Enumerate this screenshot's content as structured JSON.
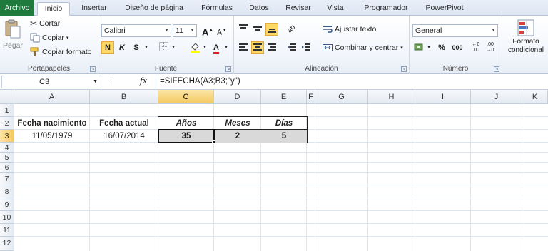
{
  "tabs": [
    "Archivo",
    "Inicio",
    "Insertar",
    "Diseño de página",
    "Fórmulas",
    "Datos",
    "Revisar",
    "Vista",
    "Programador",
    "PowerPivot"
  ],
  "clipboard": {
    "paste_label": "Pegar",
    "cut_label": "Cortar",
    "copy_label": "Copiar",
    "format_painter_label": "Copiar formato",
    "group_label": "Portapapeles"
  },
  "font": {
    "font_name": "Calibri",
    "font_size": "11",
    "bold_glyph": "N",
    "italic_glyph": "K",
    "underline_glyph": "S",
    "grow_glyph": "A",
    "shrink_glyph": "A",
    "group_label": "Fuente"
  },
  "alignment": {
    "wrap_text_label": "Ajustar texto",
    "merge_center_label": "Combinar y centrar",
    "group_label": "Alineación"
  },
  "number": {
    "format": "General",
    "percent_glyph": "%",
    "thousands_glyph": "000",
    "group_label": "Número"
  },
  "styles": {
    "conditional_format_label_1": "Formato",
    "conditional_format_label_2": "condicional"
  },
  "formula_bar": {
    "name_box": "C3",
    "fx": "fx",
    "formula": "=SIFECHA(A3;B3;\"y\")"
  },
  "columns": [
    "A",
    "B",
    "C",
    "D",
    "E",
    "F",
    "G",
    "H",
    "I",
    "J",
    "K"
  ],
  "rows": [
    "1",
    "2",
    "3",
    "4",
    "5",
    "6",
    "7",
    "8",
    "9",
    "10",
    "11",
    "12"
  ],
  "cells": {
    "a2": "Fecha nacimiento",
    "b2": "Fecha actual",
    "c2": "Años",
    "d2": "Meses",
    "e2": "Días",
    "a3": "11/05/1979",
    "b3": "16/07/2014",
    "c3": "35",
    "d3": "2",
    "e3": "5"
  },
  "colors": {
    "file_tab": "#1f7a3d",
    "selection_header": "#f3c95f",
    "shaded_cells": "#d9d9d9"
  }
}
